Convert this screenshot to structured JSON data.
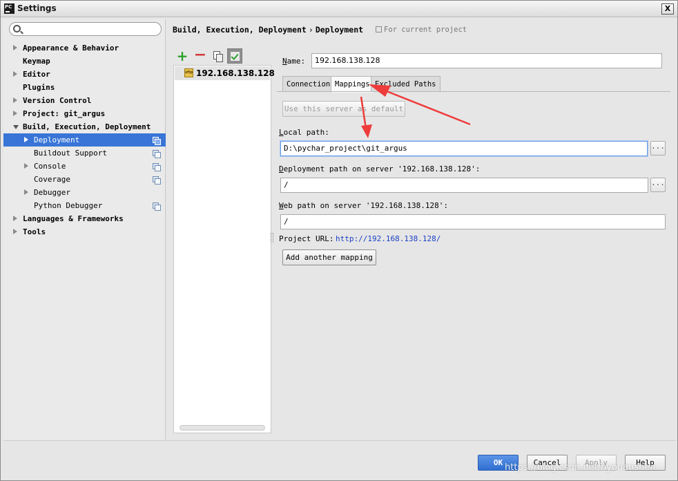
{
  "window": {
    "title": "Settings",
    "close_glyph": "X",
    "app_icon_text": "PC"
  },
  "sidebar": {
    "search_placeholder": "",
    "items": [
      {
        "label": "Appearance & Behavior",
        "expander": "collapsed",
        "bold": true
      },
      {
        "label": "Keymap",
        "expander": "none",
        "bold": true
      },
      {
        "label": "Editor",
        "expander": "collapsed",
        "bold": true
      },
      {
        "label": "Plugins",
        "expander": "none",
        "bold": true
      },
      {
        "label": "Version Control",
        "expander": "collapsed",
        "bold": true
      },
      {
        "label": "Project: git_argus",
        "expander": "collapsed",
        "bold": true
      },
      {
        "label": "Build, Execution, Deployment",
        "expander": "expanded",
        "bold": true
      },
      {
        "label": "Deployment",
        "expander": "collapsed",
        "selected": true,
        "project_icon": true
      },
      {
        "label": "Buildout Support",
        "expander": "none",
        "project_icon": true
      },
      {
        "label": "Console",
        "expander": "collapsed",
        "project_icon": true
      },
      {
        "label": "Coverage",
        "expander": "none",
        "project_icon": true
      },
      {
        "label": "Debugger",
        "expander": "collapsed"
      },
      {
        "label": "Python Debugger",
        "expander": "none",
        "project_icon": true
      },
      {
        "label": "Languages & Frameworks",
        "expander": "collapsed",
        "bold": true
      },
      {
        "label": "Tools",
        "expander": "collapsed",
        "bold": true
      }
    ]
  },
  "header": {
    "breadcrumb_parent": "Build, Execution, Deployment",
    "breadcrumb_sep": "›",
    "breadcrumb_current": "Deployment",
    "scope_note": "For current project"
  },
  "servers": {
    "toolbar": {
      "add": "+",
      "remove": "−"
    },
    "items": [
      {
        "label": "192.168.138.128",
        "icon_text": "sftp"
      }
    ]
  },
  "form": {
    "name_label_mnemonic": "N",
    "name_label_rest": "ame:",
    "name_value": "192.168.138.128",
    "tabs": [
      {
        "label": "Connection",
        "active": false
      },
      {
        "label": "Mappings",
        "active": true
      },
      {
        "label": "Excluded Paths",
        "active": false
      }
    ],
    "use_default_button": "Use this server as default",
    "local_path_mnemonic": "L",
    "local_path_rest": "ocal path:",
    "local_path_value": "D:\\pychar_project\\git_argus",
    "deploy_path_mnemonic": "D",
    "deploy_path_rest": "eployment path on server '192.168.138.128':",
    "deploy_path_value": "/",
    "web_path_mnemonic": "W",
    "web_path_rest": "eb path on server '192.168.138.128':",
    "web_path_value": "/",
    "project_url_label": "Project URL:",
    "project_url_value": "http://192.168.138.128/",
    "add_mapping_button": "Add another mapping",
    "browse_glyph": "..."
  },
  "footer": {
    "ok": "OK",
    "cancel": "Cancel",
    "apply": "Apply",
    "help": "Help"
  },
  "watermark": "https://blog.csdn.net/hyouanshen",
  "colors": {
    "selection": "#3875d7",
    "annotation_arrow": "#ee3b3b",
    "link": "#1a3fc7"
  }
}
